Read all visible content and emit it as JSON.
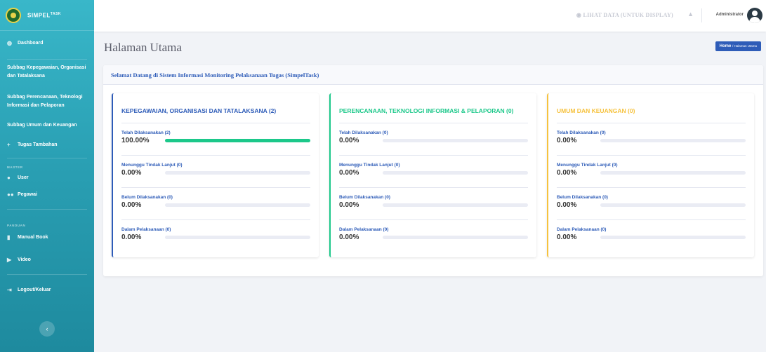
{
  "brand": {
    "name": "SIMPEL",
    "sup": "TASK"
  },
  "sidebar": {
    "items": [
      {
        "label": "Dashboard",
        "icon": "dashboard-icon"
      },
      {
        "label": "Subbag Kepegawaian, Organisasi dan Tatalaksana"
      },
      {
        "label": "Subbag Perencanaan, Teknologi Informasi dan Pelaporan"
      },
      {
        "label": "Subbag Umum dan Keuangan"
      },
      {
        "label": "Tugas Tambahan",
        "icon": "plus-icon"
      }
    ],
    "master_heading": "MASTER",
    "master_items": [
      {
        "label": "User",
        "icon": "user-icon"
      },
      {
        "label": "Pegawai",
        "icon": "users-icon"
      }
    ],
    "panduan_heading": "PANDUAN",
    "panduan_items": [
      {
        "label": "Manual Book",
        "icon": "book-icon"
      },
      {
        "label": "Video",
        "icon": "video-icon"
      }
    ],
    "logout": "Logout/Keluar"
  },
  "topbar": {
    "view_link": "LIHAT DATA (UNTUK DISPLAY)",
    "user": "Administrator"
  },
  "page": {
    "title": "Halaman Utama",
    "breadcrumb_home": "Home",
    "breadcrumb_current": "/ Halaman Utama",
    "welcome": "Selamat Datang di Sistem Informasi Monitoring Pelaksanaan Tugas (SimpelTask)"
  },
  "columns": [
    {
      "title": "KEPEGAWAIAN, ORGANISASI DAN TATALAKSANA (2)",
      "accent": "#2e5cb8",
      "stats": [
        {
          "label": "Telah Dilaksanakan (2)",
          "pct": "100.00%",
          "value": 100
        },
        {
          "label": "Menunggu Tindak Lanjut (0)",
          "pct": "0.00%",
          "value": 0
        },
        {
          "label": "Belum Dilaksanakan (0)",
          "pct": "0.00%",
          "value": 0
        },
        {
          "label": "Dalam Pelaksanaan (0)",
          "pct": "0.00%",
          "value": 0
        }
      ]
    },
    {
      "title": "PERENCANAAN, TEKNOLOGI INFORMASI & PELAPORAN (0)",
      "accent": "#1cc88a",
      "stats": [
        {
          "label": "Telah Dilaksanakan (0)",
          "pct": "0.00%",
          "value": 0
        },
        {
          "label": "Menunggu Tindak Lanjut (0)",
          "pct": "0.00%",
          "value": 0
        },
        {
          "label": "Belum Dilaksanakan (0)",
          "pct": "0.00%",
          "value": 0
        },
        {
          "label": "Dalam Pelaksanaan (0)",
          "pct": "0.00%",
          "value": 0
        }
      ]
    },
    {
      "title": "UMUM DAN KEUANGAN (0)",
      "accent": "#f6c23e",
      "stats": [
        {
          "label": "Telah Dilaksanakan (0)",
          "pct": "0.00%",
          "value": 0
        },
        {
          "label": "Menunggu Tindak Lanjut (0)",
          "pct": "0.00%",
          "value": 0
        },
        {
          "label": "Belum Dilaksanakan (0)",
          "pct": "0.00%",
          "value": 0
        },
        {
          "label": "Dalam Pelaksanaan (0)",
          "pct": "0.00%",
          "value": 0
        }
      ]
    }
  ]
}
